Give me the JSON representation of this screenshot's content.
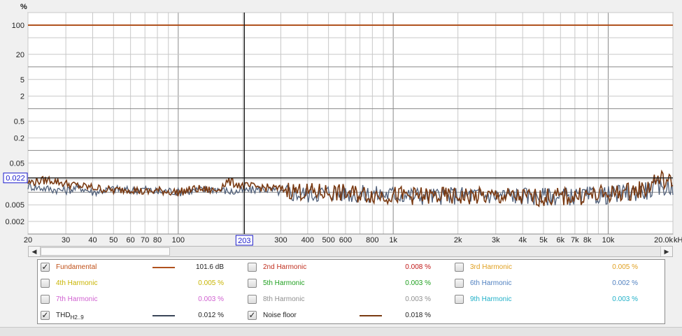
{
  "chart_data": {
    "type": "line",
    "yunit_label": "%",
    "x_unit_label": "kHz",
    "xlim": [
      20,
      20000
    ],
    "ylim": [
      0.001,
      200
    ],
    "x_scale": "log",
    "y_scale": "log",
    "y_ticks": [
      {
        "v": 100,
        "label": "100"
      },
      {
        "v": 20,
        "label": "20"
      },
      {
        "v": 5,
        "label": "5"
      },
      {
        "v": 2,
        "label": "2"
      },
      {
        "v": 0.5,
        "label": "0.5"
      },
      {
        "v": 0.2,
        "label": "0.2"
      },
      {
        "v": 0.05,
        "label": "0.05"
      },
      {
        "v": 0.005,
        "label": "0.005"
      },
      {
        "v": 0.002,
        "label": "0.002"
      }
    ],
    "x_ticks": [
      {
        "v": 20,
        "label": "20"
      },
      {
        "v": 30,
        "label": "30"
      },
      {
        "v": 40,
        "label": "40"
      },
      {
        "v": 50,
        "label": "50"
      },
      {
        "v": 60,
        "label": "60"
      },
      {
        "v": 70,
        "label": "70"
      },
      {
        "v": 80,
        "label": "80"
      },
      {
        "v": 100,
        "label": "100"
      },
      {
        "v": 300,
        "label": "300"
      },
      {
        "v": 400,
        "label": "400"
      },
      {
        "v": 500,
        "label": "500"
      },
      {
        "v": 600,
        "label": "600"
      },
      {
        "v": 800,
        "label": "800"
      },
      {
        "v": 1000,
        "label": "1k"
      },
      {
        "v": 2000,
        "label": "2k"
      },
      {
        "v": 3000,
        "label": "3k"
      },
      {
        "v": 4000,
        "label": "4k"
      },
      {
        "v": 5000,
        "label": "5k"
      },
      {
        "v": 6000,
        "label": "6k"
      },
      {
        "v": 7000,
        "label": "7k"
      },
      {
        "v": 8000,
        "label": "8k"
      },
      {
        "v": 10000,
        "label": "10k"
      },
      {
        "v": 20000,
        "label": "20.0k"
      }
    ],
    "cursor": {
      "x": 203,
      "x_label": "203",
      "y": 0.022,
      "y_label": "0.022"
    },
    "series": [
      {
        "name": "Fundamental",
        "color": "#b0521e",
        "constant": 100
      },
      {
        "name": "THD H2..9",
        "color": "#50607a",
        "points": [
          [
            20,
            0.014
          ],
          [
            25,
            0.012
          ],
          [
            30,
            0.011
          ],
          [
            35,
            0.013
          ],
          [
            40,
            0.01
          ],
          [
            50,
            0.012
          ],
          [
            60,
            0.011
          ],
          [
            70,
            0.012
          ],
          [
            80,
            0.01
          ],
          [
            90,
            0.011
          ],
          [
            100,
            0.01
          ],
          [
            120,
            0.011
          ],
          [
            150,
            0.012
          ],
          [
            180,
            0.01
          ],
          [
            203,
            0.011
          ],
          [
            250,
            0.012
          ],
          [
            300,
            0.01
          ],
          [
            400,
            0.009
          ],
          [
            500,
            0.01
          ],
          [
            700,
            0.009
          ],
          [
            1000,
            0.009
          ],
          [
            1500,
            0.008
          ],
          [
            2000,
            0.0085
          ],
          [
            3000,
            0.0085
          ],
          [
            5000,
            0.008
          ],
          [
            7000,
            0.008
          ],
          [
            10000,
            0.0085
          ],
          [
            15000,
            0.011
          ],
          [
            20000,
            0.014
          ]
        ]
      },
      {
        "name": "Noise floor",
        "color": "#7a3a12",
        "points": [
          [
            20,
            0.017
          ],
          [
            25,
            0.02
          ],
          [
            30,
            0.016
          ],
          [
            35,
            0.014
          ],
          [
            40,
            0.013
          ],
          [
            50,
            0.011
          ],
          [
            60,
            0.012
          ],
          [
            70,
            0.01
          ],
          [
            80,
            0.011
          ],
          [
            100,
            0.01
          ],
          [
            120,
            0.012
          ],
          [
            150,
            0.011
          ],
          [
            170,
            0.018
          ],
          [
            203,
            0.014
          ],
          [
            250,
            0.013
          ],
          [
            300,
            0.012
          ],
          [
            400,
            0.01
          ],
          [
            500,
            0.01
          ],
          [
            700,
            0.009
          ],
          [
            1000,
            0.0085
          ],
          [
            1500,
            0.008
          ],
          [
            2000,
            0.008
          ],
          [
            3000,
            0.008
          ],
          [
            5000,
            0.0075
          ],
          [
            7000,
            0.008
          ],
          [
            10000,
            0.009
          ],
          [
            15000,
            0.012
          ],
          [
            17000,
            0.022
          ],
          [
            20000,
            0.016
          ]
        ]
      }
    ]
  },
  "legend": {
    "items": [
      {
        "label": "Fundamental",
        "checked": true,
        "color": "#c05018",
        "swatch": "#b0521e",
        "value": "101.6 dB",
        "col": 0
      },
      {
        "label": "2nd Harmonic",
        "checked": false,
        "color": "#c03020",
        "value": "0.008 %",
        "col": 1
      },
      {
        "label": "3rd Harmonic",
        "checked": false,
        "color": "#e0a020",
        "value": "0.005 %",
        "col": 2
      },
      {
        "label": "4th Harmonic",
        "checked": false,
        "color": "#c8b400",
        "value": "0.005 %",
        "col": 0
      },
      {
        "label": "5th Harmonic",
        "checked": false,
        "color": "#20a020",
        "value": "0.003 %",
        "col": 1
      },
      {
        "label": "6th Harmonic",
        "checked": false,
        "color": "#5080c0",
        "value": "0.002 %",
        "col": 2
      },
      {
        "label": "7th Harmonic",
        "checked": false,
        "color": "#d060d0",
        "value": "0.003 %",
        "col": 0
      },
      {
        "label": "8th Harmonic",
        "checked": false,
        "color": "#909090",
        "value": "0.003 %",
        "col": 1
      },
      {
        "label": "9th Harmonic",
        "checked": false,
        "color": "#20b0c8",
        "value": "0.003 %",
        "col": 2
      },
      {
        "label": "THD",
        "sub": "H2..9",
        "checked": true,
        "color": "#222222",
        "swatch": "#3a4658",
        "value": "0.012 %",
        "col": 0
      },
      {
        "label": "Noise floor",
        "checked": true,
        "color": "#222222",
        "swatch": "#7a3a12",
        "value": "0.018 %",
        "col": 1
      }
    ]
  },
  "scrollbar": {
    "left_arrow": "◀",
    "right_arrow": "▶"
  }
}
